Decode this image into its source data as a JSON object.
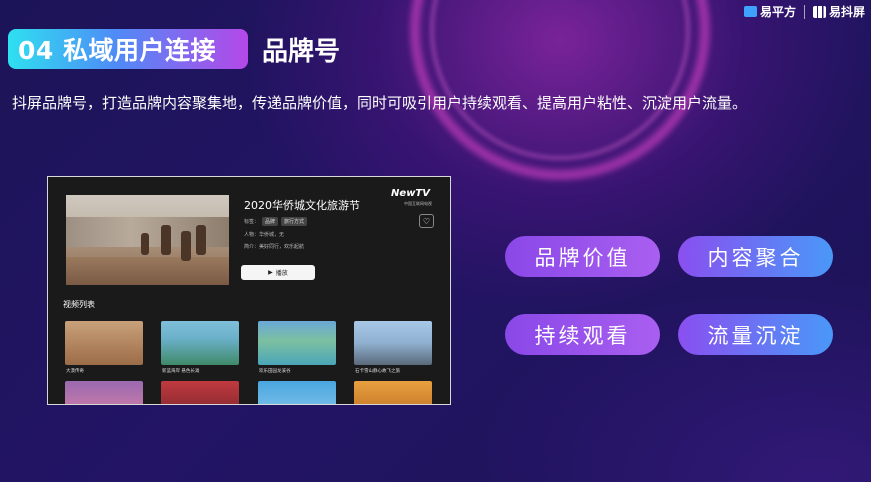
{
  "brand": {
    "logo1": "易平方",
    "logo2": "易抖屏"
  },
  "header": {
    "badge": "04 私域用户连接",
    "title": "品牌号"
  },
  "description": "抖屏品牌号，打造品牌内容聚集地，传递品牌价值，同时可吸引用户持续观看、提高用户粘性、沉淀用户流量。",
  "screenshot": {
    "title": "2020华侨城文化旅游节",
    "tags_label": "标签：",
    "tags": [
      "品牌",
      "旅行方式"
    ],
    "people": "人物：华侨城，无",
    "intro": "简介：美好同行，欢乐起航",
    "play_label": "播放",
    "channel_logo": "NewTV",
    "channel_sub": "中国互联网电视",
    "list_title": "视频列表",
    "videos": [
      {
        "caption": "大漠传奇"
      },
      {
        "caption": "新蓝海岸 悬色长滩"
      },
      {
        "caption": "欢乐田园龙溪谷"
      },
      {
        "caption": "石卡雪山静心故飞之旅"
      }
    ]
  },
  "features": [
    {
      "label": "品牌价值"
    },
    {
      "label": "内容聚合"
    },
    {
      "label": "持续观看"
    },
    {
      "label": "流量沉淀"
    }
  ]
}
